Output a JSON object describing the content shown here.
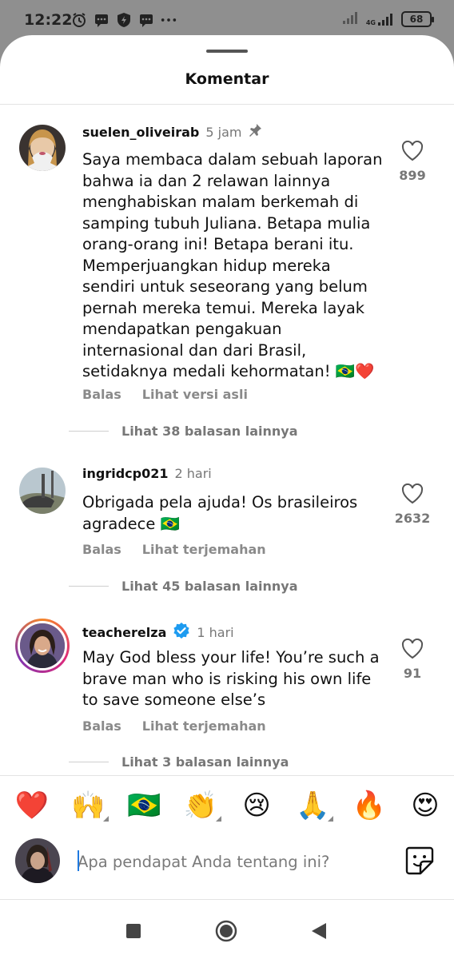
{
  "status_bar": {
    "time": "12:22",
    "network_label": "4G",
    "battery": "68",
    "icons": [
      "alarm-icon",
      "message-icon",
      "shield-icon",
      "message-icon",
      "more-dots-icon",
      "signal-icon",
      "signal-4g-icon"
    ]
  },
  "sheet": {
    "title": "Komentar"
  },
  "comments": [
    {
      "username": "suelen_oliveirab",
      "time": "5 jam",
      "pinned": true,
      "verified": false,
      "text": "Saya membaca dalam sebuah laporan\nbahwa ia dan 2 relawan lainnya\nmenghabiskan malam berkemah di\nsamping tubuh Juliana. Betapa mulia\norang-orang ini! Betapa berani itu.\nMemperjuangkan hidup mereka\nsendiri untuk seseorang yang belum\npernah mereka temui. Mereka layak\nmendapatkan pengakuan\ninternasional dan dari Brasil,\nsetidaknya medali kehormatan! 🇧🇷❤️",
      "likes": "899",
      "reply_label": "Balas",
      "secondary_action": "Lihat versi asli",
      "more_replies": "Lihat 38 balasan lainnya"
    },
    {
      "username": "ingridcp021",
      "time": "2 hari",
      "pinned": false,
      "verified": false,
      "text": "Obrigada pela ajuda! Os brasileiros\nagradece 🇧🇷",
      "likes": "2632",
      "reply_label": "Balas",
      "secondary_action": "Lihat terjemahan",
      "more_replies": "Lihat 45 balasan lainnya"
    },
    {
      "username": "teacherelza",
      "time": "1 hari",
      "pinned": false,
      "verified": true,
      "text": "May God bless your life! You’re such a\nbrave man who is risking his own life\nto save someone else’s",
      "likes": "91",
      "reply_label": "Balas",
      "secondary_action": "Lihat terjemahan",
      "more_replies": "Lihat 3 balasan lainnya"
    }
  ],
  "quick_reactions": [
    "❤️",
    "🙌",
    "🇧🇷",
    "👏",
    "😢",
    "🙏",
    "🔥",
    "😍"
  ],
  "composer": {
    "placeholder": "Apa pendapat Anda tentang ini?"
  },
  "nav": [
    "recents-square-icon",
    "home-circle-icon",
    "back-triangle-icon"
  ],
  "colors": {
    "accent": "#1f7ae0",
    "verified": "#1d9bf0",
    "heart": "#e0262e"
  }
}
